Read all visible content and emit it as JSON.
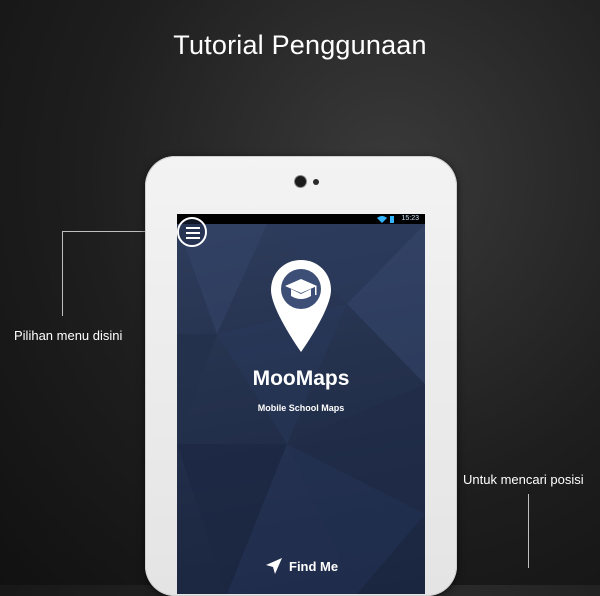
{
  "title": "Tutorial Penggunaan",
  "annotations": {
    "menu": "Pilihan menu disini",
    "find": "Untuk mencari posisi"
  },
  "status_bar": {
    "time": "15:23"
  },
  "app": {
    "name": "MooMaps",
    "subtitle": "Mobile School Maps",
    "find_button": "Find Me"
  },
  "icons": {
    "menu": "hamburger-menu-icon",
    "logo": "graduation-cap-pin-icon",
    "find": "navigation-arrow-icon",
    "wifi": "wifi-icon",
    "battery": "battery-icon"
  },
  "colors": {
    "screen_background": "#25324e",
    "title_text": "#ffffff",
    "tablet_frame": "#ececec"
  }
}
